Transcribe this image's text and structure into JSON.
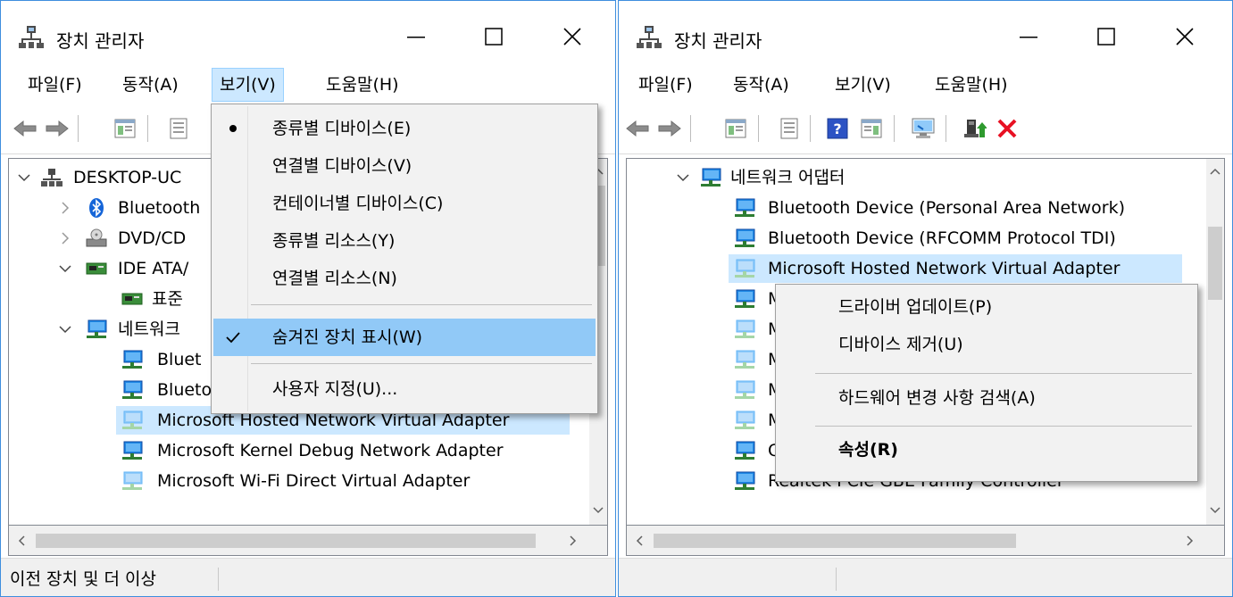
{
  "left_window": {
    "title": "장치 관리자",
    "menu": [
      "파일(F)",
      "동작(A)",
      "보기(V)",
      "도움말(H)"
    ],
    "active_menu": "보기(V)",
    "tree": [
      {
        "label": "DESKTOP-UC",
        "expander": "expanded",
        "icon": "computer-icon"
      },
      {
        "label": "Bluetooth",
        "expander": "collapsed",
        "icon": "bluetooth-icon"
      },
      {
        "label": "DVD/CD",
        "expander": "collapsed",
        "icon": "dvd-drive-icon"
      },
      {
        "label": "IDE ATA/",
        "expander": "expanded",
        "icon": "ide-controller-icon"
      },
      {
        "label": "표준",
        "expander": "none",
        "icon": "ide-controller-icon"
      },
      {
        "label": "네트워크",
        "expander": "expanded",
        "icon": "network-adapter-icon"
      },
      {
        "label": "Bluet",
        "expander": "none",
        "icon": "network-adapter-icon"
      },
      {
        "label": "Blueto",
        "expander": "none",
        "icon": "network-adapter-icon"
      },
      {
        "label": "Microsoft Hosted Network Virtual Adapter",
        "expander": "none",
        "icon": "network-adapter-faded-icon",
        "selected": true
      },
      {
        "label": "Microsoft Kernel Debug Network Adapter",
        "expander": "none",
        "icon": "network-adapter-icon"
      },
      {
        "label": "Microsoft Wi-Fi Direct Virtual Adapter",
        "expander": "none",
        "icon": "network-adapter-faded-icon"
      }
    ],
    "view_menu": [
      {
        "label": "종류별 디바이스(E)",
        "mark": "bullet"
      },
      {
        "label": "연결별 디바이스(V)",
        "mark": ""
      },
      {
        "label": "컨테이너별 디바이스(C)",
        "mark": ""
      },
      {
        "label": "종류별 리소스(Y)",
        "mark": ""
      },
      {
        "label": "연결별 리소스(N)",
        "mark": ""
      },
      {
        "label": "숨겨진 장치 표시(W)",
        "mark": "check",
        "highlighted": true
      },
      {
        "label": "사용자 지정(U)...",
        "mark": ""
      }
    ],
    "status": "이전 장치 및 더 이상"
  },
  "right_window": {
    "title": "장치 관리자",
    "menu": [
      "파일(F)",
      "동작(A)",
      "보기(V)",
      "도움말(H)"
    ],
    "tree": [
      {
        "label": "네트워크 어댑터",
        "expander": "expanded",
        "icon": "network-adapter-icon"
      },
      {
        "label": "Bluetooth Device (Personal Area Network)",
        "expander": "none",
        "icon": "network-adapter-icon"
      },
      {
        "label": "Bluetooth Device (RFCOMM Protocol TDI)",
        "expander": "none",
        "icon": "network-adapter-icon"
      },
      {
        "label": "Microsoft Hosted Network Virtual Adapter",
        "expander": "none",
        "icon": "network-adapter-faded-icon",
        "selected": true
      },
      {
        "label": "M",
        "expander": "none",
        "icon": "network-adapter-icon"
      },
      {
        "label": "M",
        "expander": "none",
        "icon": "network-adapter-faded-icon"
      },
      {
        "label": "M",
        "expander": "none",
        "icon": "network-adapter-faded-icon"
      },
      {
        "label": "M",
        "expander": "none",
        "icon": "network-adapter-faded-icon"
      },
      {
        "label": "M",
        "expander": "none",
        "icon": "network-adapter-faded-icon"
      },
      {
        "label": "C",
        "expander": "none",
        "icon": "network-adapter-icon"
      },
      {
        "label": "Realtek PCIe GBE Family Controller",
        "expander": "none",
        "icon": "network-adapter-icon"
      }
    ],
    "context_menu": [
      {
        "label": "드라이버 업데이트(P)",
        "bold": false
      },
      {
        "label": "디바이스 제거(U)",
        "bold": false
      },
      {
        "label": "하드웨어 변경 사항 검색(A)",
        "bold": false
      },
      {
        "label": "속성(R)",
        "bold": true
      }
    ],
    "status": ""
  },
  "colors": {
    "window_border": "#3e8ede",
    "selection": "#cce8ff",
    "menu_highlight": "#91c9f7",
    "delete_red": "#e81123",
    "help_blue": "#2c53c4"
  }
}
